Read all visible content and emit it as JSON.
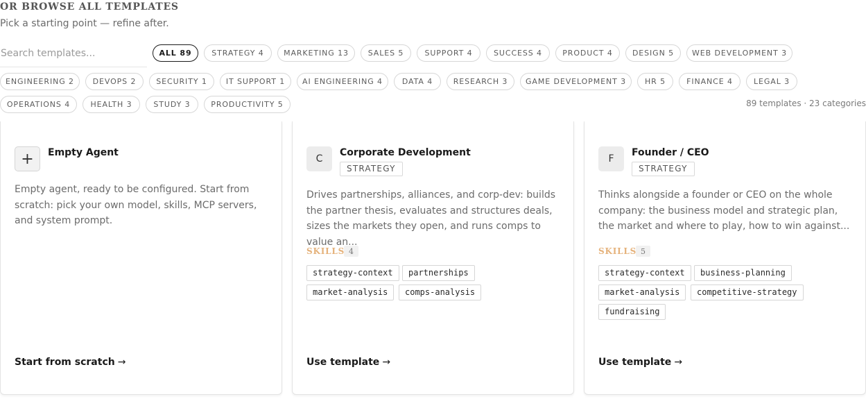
{
  "header": {
    "title": "OR BROWSE ALL TEMPLATES",
    "subtitle": "Pick a starting point — refine after."
  },
  "search": {
    "placeholder": "Search templates...",
    "value": ""
  },
  "filters": [
    {
      "label": "ALL 89",
      "active": true
    },
    {
      "label": "STRATEGY 4"
    },
    {
      "label": "MARKETING 13"
    },
    {
      "label": "SALES 5"
    },
    {
      "label": "SUPPORT 4"
    },
    {
      "label": "SUCCESS 4"
    },
    {
      "label": "PRODUCT 4"
    },
    {
      "label": "DESIGN 5"
    },
    {
      "label": "WEB DEVELOPMENT 3"
    },
    {
      "label": "ENGINEERING 2"
    },
    {
      "label": "DEVOPS 2"
    },
    {
      "label": "SECURITY 1"
    },
    {
      "label": "IT SUPPORT 1"
    },
    {
      "label": "AI ENGINEERING 4"
    },
    {
      "label": "DATA 4"
    },
    {
      "label": "RESEARCH 3"
    },
    {
      "label": "GAME DEVELOPMENT 3"
    },
    {
      "label": "HR 5"
    },
    {
      "label": "FINANCE 4"
    },
    {
      "label": "LEGAL 3"
    },
    {
      "label": "OPERATIONS 4"
    },
    {
      "label": "HEALTH 3"
    },
    {
      "label": "STUDY 3"
    },
    {
      "label": "PRODUCTIVITY 5"
    }
  ],
  "summary": "89 templates · 23 categories",
  "cards": [
    {
      "icon": "plus-icon",
      "icon_glyph": "+",
      "title": "Empty Agent",
      "description": "Empty agent, ready to be configured. Start from scratch: pick your own model, skills, MCP servers, and system prompt.",
      "action": "Start from scratch"
    },
    {
      "icon_glyph": "C",
      "title": "Corporate Development",
      "tag": "STRATEGY",
      "description": "Drives partnerships, alliances, and corp-dev: builds the partner thesis, evaluates and structures deals, sizes the markets they open, and runs comps to value an...",
      "skills_label": "SKILLS",
      "skills_count": "4",
      "skills": [
        "strategy-context",
        "partnerships",
        "market-analysis",
        "comps-analysis"
      ],
      "action": "Use template"
    },
    {
      "icon_glyph": "F",
      "title": "Founder / CEO",
      "tag": "STRATEGY",
      "description": "Thinks alongside a founder or CEO on the whole company: the business model and strategic plan, the market and where to play, how to win against...",
      "skills_label": "SKILLS",
      "skills_count": "5",
      "skills": [
        "strategy-context",
        "business-planning",
        "market-analysis",
        "competitive-strategy",
        "fundraising"
      ],
      "action": "Use template"
    }
  ],
  "colors": {
    "skills_accent": "#e5b27b",
    "active_chip_border": "#1a1a1a"
  }
}
